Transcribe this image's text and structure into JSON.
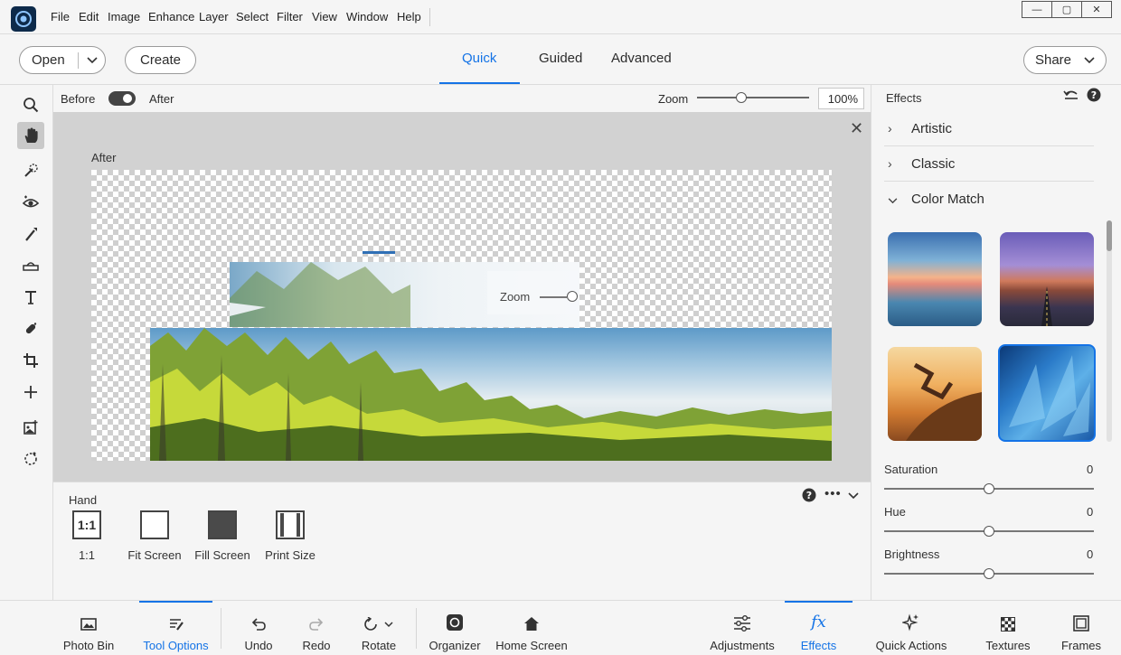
{
  "menu": [
    "File",
    "Edit",
    "Image",
    "Enhance",
    "Layer",
    "Select",
    "Filter",
    "View",
    "Window",
    "Help"
  ],
  "mode_bar": {
    "open_label": "Open",
    "create_label": "Create",
    "share_label": "Share",
    "tabs": [
      "Quick",
      "Guided",
      "Advanced"
    ],
    "active_tab": "Quick"
  },
  "view_bar": {
    "before_label": "Before",
    "after_label": "After",
    "zoom_label": "Zoom",
    "zoom_value": "100%"
  },
  "canvas": {
    "after_label": "After",
    "overlay_zoom_label": "Zoom"
  },
  "tool_options": {
    "tool_name": "Hand",
    "options": [
      {
        "label": "1:1",
        "icon_text": "1:1"
      },
      {
        "label": "Fit Screen"
      },
      {
        "label": "Fill Screen"
      },
      {
        "label": "Print Size"
      }
    ]
  },
  "effects": {
    "title": "Effects",
    "sections": [
      "Artistic",
      "Classic",
      "Color Match"
    ],
    "sliders": [
      {
        "label": "Saturation",
        "value": "0"
      },
      {
        "label": "Hue",
        "value": "0"
      },
      {
        "label": "Brightness",
        "value": "0"
      }
    ]
  },
  "bottom_bar": {
    "photo_bin": "Photo Bin",
    "tool_options": "Tool Options",
    "undo": "Undo",
    "redo": "Redo",
    "rotate": "Rotate",
    "organizer": "Organizer",
    "home_screen": "Home Screen",
    "adjustments": "Adjustments",
    "effects": "Effects",
    "quick_actions": "Quick Actions",
    "textures": "Textures",
    "frames": "Frames"
  },
  "colors": {
    "accent": "#1473e6",
    "panel": "#f5f5f5",
    "canvas_bg": "#d2d2d2"
  }
}
